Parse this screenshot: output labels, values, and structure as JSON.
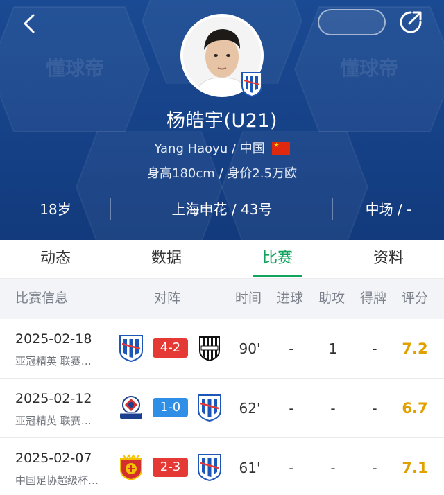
{
  "header": {
    "watermark": "懂球帝",
    "player_name": "杨皓宇(U21)",
    "name_en": "Yang Haoyu",
    "separator": " / ",
    "nationality": "中国",
    "height_value": "身高180cm / 身价2.5万欧",
    "age": "18岁",
    "club_number": "上海申花 / 43号",
    "position": "中场 / -"
  },
  "tabs": [
    {
      "label": "动态",
      "active": false
    },
    {
      "label": "数据",
      "active": false
    },
    {
      "label": "比赛",
      "active": true
    },
    {
      "label": "资料",
      "active": false
    }
  ],
  "table": {
    "headers": {
      "info": "比赛信息",
      "matchup": "对阵",
      "time": "时间",
      "goals": "进球",
      "assists": "助攻",
      "cards": "得牌",
      "rating": "评分"
    },
    "rows": [
      {
        "date": "2025-02-18",
        "competition": "亚冠精英 联赛…",
        "home_logo": "shenhua-crest-icon",
        "score": "4-2",
        "result": "loss",
        "away_logo": "vissel-kobe-crest-icon",
        "time": "90'",
        "goals": "-",
        "assists": "1",
        "cards": "-",
        "rating": "7.2"
      },
      {
        "date": "2025-02-12",
        "competition": "亚冠精英 联赛…",
        "home_logo": "yokohama-fmarinos-crest-icon",
        "score": "1-0",
        "result": "win",
        "away_logo": "shenhua-crest-icon",
        "time": "62'",
        "goals": "-",
        "assists": "-",
        "cards": "-",
        "rating": "6.7"
      },
      {
        "date": "2025-02-07",
        "competition": "中国足协超级杯…",
        "home_logo": "port-crest-icon",
        "score": "2-3",
        "result": "loss",
        "away_logo": "shenhua-crest-icon",
        "time": "61'",
        "goals": "-",
        "assists": "-",
        "cards": "-",
        "rating": "7.1"
      }
    ]
  },
  "colors": {
    "header_blue": "#17438a",
    "accent_green": "#12a35d",
    "loss_red": "#e53935",
    "win_blue": "#2f8fe6",
    "rating_gold": "#e0a100"
  }
}
